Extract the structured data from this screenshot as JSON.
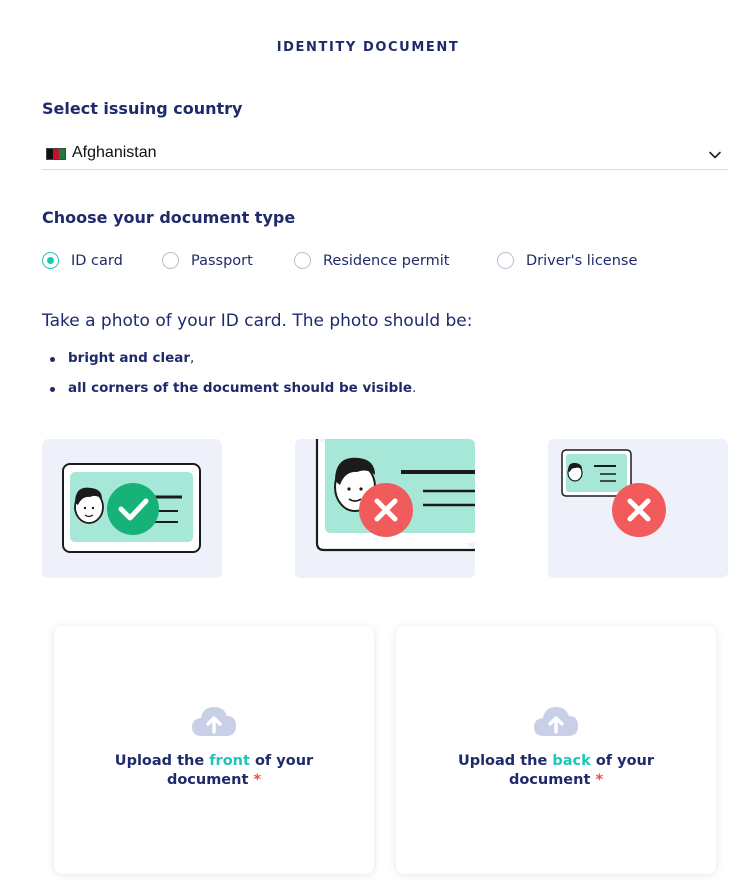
{
  "header": {
    "title": "IDENTITY DOCUMENT"
  },
  "country": {
    "label": "Select issuing country",
    "selected": "Afghanistan",
    "flag_icon": "afghanistan-flag-icon"
  },
  "doc_type": {
    "label": "Choose your document type",
    "options": [
      {
        "label": "ID card",
        "checked": true
      },
      {
        "label": "Passport",
        "checked": false
      },
      {
        "label": "Residence permit",
        "checked": false
      },
      {
        "label": "Driver's license",
        "checked": false
      }
    ]
  },
  "instructions": {
    "text": "Take a photo of your ID card. The photo should be:",
    "bullets": [
      {
        "bold": "bright and clear",
        "rest": ","
      },
      {
        "bold": "all corners of the document should be visible",
        "rest": "."
      }
    ]
  },
  "examples": [
    {
      "status": "correct",
      "icon": "check-icon"
    },
    {
      "status": "too-close",
      "icon": "cross-icon"
    },
    {
      "status": "too-far",
      "icon": "cross-icon"
    }
  ],
  "uploads": {
    "front": {
      "pre": "Upload the ",
      "highlight": "front",
      "post": " of your",
      "line2": "document",
      "required": "*"
    },
    "back": {
      "pre": "Upload the ",
      "highlight": "back",
      "post": " of your",
      "line2": "document",
      "required": "*"
    }
  },
  "colors": {
    "primary": "#1f2a6b",
    "accent": "#1ec7b5",
    "error": "#f25b5b",
    "card_bg": "#eef1f9"
  }
}
